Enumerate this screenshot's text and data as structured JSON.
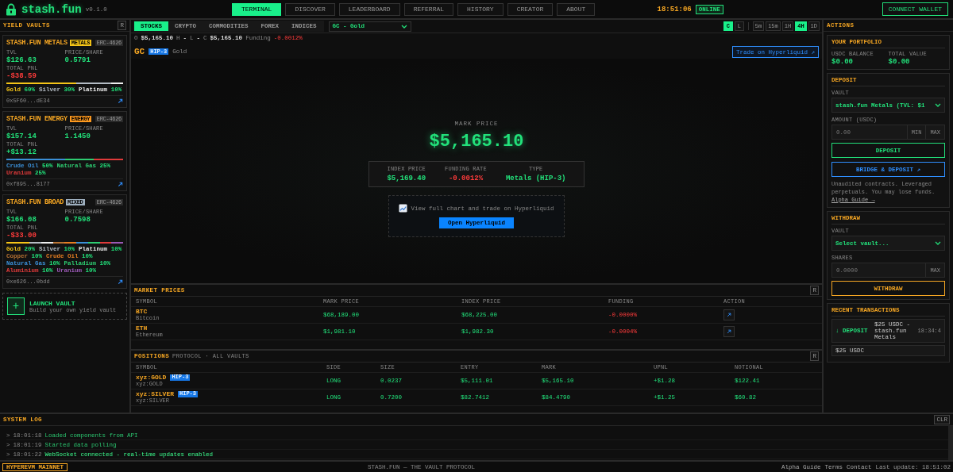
{
  "header": {
    "logo": "stash.fun",
    "version": "v0.1.0",
    "nav": [
      {
        "label": "TERMINAL",
        "selected": true
      },
      {
        "label": "DISCOVER",
        "selected": false
      },
      {
        "label": "LEADERBOARD",
        "selected": false
      },
      {
        "label": "REFERRAL",
        "selected": false
      },
      {
        "label": "HISTORY",
        "selected": false
      },
      {
        "label": "CREATOR",
        "selected": false
      },
      {
        "label": "ABOUT",
        "selected": false
      }
    ],
    "clock": "18:51:06",
    "status": "ONLINE",
    "connect": "CONNECT WALLET"
  },
  "vaults_panel": {
    "title": "YIELD VAULTS",
    "refresh": "R",
    "vaults": [
      {
        "name": "STASH.FUN METALS",
        "badge": {
          "label": "METALS",
          "color": "#f5c518"
        },
        "standard": "ERC-4626",
        "tvl_label": "TVL",
        "tvl": "$126.63",
        "price_label": "PRICE/SHARE",
        "price": "0.5791",
        "pnl_label": "TOTAL PNL",
        "pnl": "-$38.59",
        "pnl_positive": false,
        "allocations": [
          {
            "name": "Gold",
            "pct": "60%",
            "color": "#f5c518"
          },
          {
            "name": "Silver",
            "pct": "30%",
            "color": "#b4bcc4"
          },
          {
            "name": "Platinum",
            "pct": "10%",
            "color": "#eeeeee"
          }
        ],
        "address": "0x5F60...dE34"
      },
      {
        "name": "STASH.FUN ENERGY",
        "badge": {
          "label": "ENERGY",
          "color": "#ff9a1f"
        },
        "standard": "ERC-4626",
        "tvl_label": "TVL",
        "tvl": "$157.14",
        "price_label": "PRICE/SHARE",
        "price": "1.1450",
        "pnl_label": "TOTAL PNL",
        "pnl": "+$13.12",
        "pnl_positive": true,
        "allocations": [
          {
            "name": "Crude Oil",
            "pct": "50%",
            "color": "#3b8fd6"
          },
          {
            "name": "Natural Gas",
            "pct": "25%",
            "color": "#2ecc71"
          },
          {
            "name": "Uranium",
            "pct": "25%",
            "color": "#e03a3a"
          }
        ],
        "address": "0xf895...8177"
      },
      {
        "name": "STASH.FUN BROAD",
        "badge": {
          "label": "MIXED",
          "color": "#9fb0c0"
        },
        "standard": "ERC-4626",
        "tvl_label": "TVL",
        "tvl": "$166.08",
        "price_label": "PRICE/SHARE",
        "price": "0.7598",
        "pnl_label": "TOTAL PNL",
        "pnl": "-$33.00",
        "pnl_positive": false,
        "allocations": [
          {
            "name": "Gold",
            "pct": "20%",
            "color": "#f5c518"
          },
          {
            "name": "Silver",
            "pct": "10%",
            "color": "#b4bcc4"
          },
          {
            "name": "Platinum",
            "pct": "10%",
            "color": "#eeeeee"
          },
          {
            "name": "Copper",
            "pct": "10%",
            "color": "#b87333"
          },
          {
            "name": "Crude Oil",
            "pct": "10%",
            "color": "#e67e22"
          },
          {
            "name": "Natural Gas",
            "pct": "10%",
            "color": "#3b8fd6"
          },
          {
            "name": "Palladium",
            "pct": "10%",
            "color": "#2ecc71"
          },
          {
            "name": "Aluminium",
            "pct": "10%",
            "color": "#e03a3a"
          },
          {
            "name": "Uranium",
            "pct": "10%",
            "color": "#9b59b6"
          }
        ],
        "address": "0xe626...0bdd"
      }
    ],
    "launch": {
      "icon": "+",
      "title": "LAUNCH VAULT",
      "subtitle": "Build your own yield vault"
    }
  },
  "market": {
    "categories": [
      {
        "label": "STOCKS",
        "selected": true
      },
      {
        "label": "CRYPTO",
        "selected": false
      },
      {
        "label": "COMMODITIES",
        "selected": false
      },
      {
        "label": "FOREX",
        "selected": false
      },
      {
        "label": "INDICES",
        "selected": false
      }
    ],
    "symbol_select": "GC - Gold",
    "chart_modes": [
      {
        "label": "C",
        "selected": true
      },
      {
        "label": "L",
        "selected": false
      }
    ],
    "timeframes": [
      {
        "label": "5m",
        "selected": false
      },
      {
        "label": "15m",
        "selected": false
      },
      {
        "label": "1H",
        "selected": false
      },
      {
        "label": "4H",
        "selected": true
      },
      {
        "label": "1D",
        "selected": false
      }
    ],
    "ohlc": [
      {
        "label": "O",
        "value": "$5,165.10"
      },
      {
        "label": "H",
        "value": "-"
      },
      {
        "label": "L",
        "value": "-"
      },
      {
        "label": "C",
        "value": "$5,165.10"
      }
    ],
    "funding_label": "Funding",
    "funding": "-0.0012%",
    "instrument": {
      "symbol": "GC",
      "tag": "HIP-3",
      "name": "Gold",
      "trade_link": "Trade on Hyperliquid ↗"
    },
    "mark_label": "MARK PRICE",
    "mark_price": "$5,165.10",
    "stats": [
      {
        "label": "INDEX PRICE",
        "value": "$5,169.40",
        "kind": "up"
      },
      {
        "label": "FUNDING RATE",
        "value": "-0.0012%",
        "kind": "down"
      },
      {
        "label": "TYPE",
        "value": "Metals (HIP-3)",
        "kind": "up"
      }
    ],
    "cta_text": "View full chart and trade on Hyperliquid",
    "cta_button": "Open Hyperliquid"
  },
  "market_prices": {
    "title": "MARKET PRICES",
    "refresh": "R",
    "columns": [
      "SYMBOL",
      "MARK PRICE",
      "INDEX PRICE",
      "FUNDING",
      "ACTION"
    ],
    "rows": [
      {
        "symbol": "BTC",
        "name": "Bitcoin",
        "mark": "$68,189.00",
        "index": "$68,225.00",
        "funding": "-0.0000%"
      },
      {
        "symbol": "ETH",
        "name": "Ethereum",
        "mark": "$1,981.10",
        "index": "$1,982.30",
        "funding": "-0.0004%"
      }
    ]
  },
  "positions": {
    "title": "POSITIONS",
    "subtitle": "PROTOCOL · ALL VAULTS",
    "refresh": "R",
    "columns": [
      "SYMBOL",
      "SIDE",
      "SIZE",
      "ENTRY",
      "MARK",
      "UPNL",
      "NOTIONAL"
    ],
    "rows": [
      {
        "symbol": "xyz:GOLD",
        "tag": "HIP-3",
        "sub": "xyz:GOLD",
        "side": "LONG",
        "size": "0.0237",
        "entry": "$5,111.01",
        "mark": "$5,165.10",
        "upnl": "+$1.28",
        "notional": "$122.41"
      },
      {
        "symbol": "xyz:SILVER",
        "tag": "HIP-3",
        "sub": "xyz:SILVER",
        "side": "LONG",
        "size": "0.7200",
        "entry": "$82.7412",
        "mark": "$84.4790",
        "upnl": "+$1.25",
        "notional": "$60.82"
      }
    ]
  },
  "actions": {
    "title": "ACTIONS",
    "portfolio": {
      "title": "YOUR PORTFOLIO",
      "balance_label": "USDC BALANCE",
      "balance": "$0.00",
      "total_label": "TOTAL VALUE",
      "total": "$0.00"
    },
    "deposit": {
      "title": "DEPOSIT",
      "vault_label": "VAULT",
      "vault_value": "stash.fun Metals (TVL: $1",
      "amount_label": "AMOUNT (USDC)",
      "amount_placeholder": "0.00",
      "min": "MIN",
      "max": "MAX",
      "button": "DEPOSIT",
      "bridge_button": "BRIDGE & DEPOSIT ↗",
      "warning": "Unaudited contracts. Leveraged perpetuals. You may lose funds.",
      "guide_link": "Alpha Guide →"
    },
    "withdraw": {
      "title": "WITHDRAW",
      "vault_label": "VAULT",
      "vault_value": "Select vault...",
      "shares_label": "SHARES",
      "shares_placeholder": "0.0000",
      "max": "MAX",
      "button": "WITHDRAW"
    },
    "transactions": {
      "title": "RECENT TRANSACTIONS",
      "items": [
        {
          "arrow": "↓",
          "type": "DEPOSIT",
          "detail": "$25 USDC - stash.fun Metals",
          "time": "18:34:4"
        },
        {
          "detail": "$25 USDC"
        }
      ]
    }
  },
  "system_log": {
    "title": "SYSTEM LOG",
    "clear": "CLR",
    "entries": [
      {
        "prompt": ">",
        "time": "18:01:18",
        "message": "Loaded components from API",
        "kind": "info"
      },
      {
        "prompt": ">",
        "time": "18:01:19",
        "message": "Started data polling",
        "kind": "info"
      },
      {
        "prompt": ">",
        "time": "18:01:22",
        "message": "WebSocket connected - real-time updates enabled",
        "kind": "success"
      }
    ]
  },
  "footer": {
    "network": "HYPEREVM MAINNET",
    "tagline": "STASH.FUN — THE VAULT PROTOCOL",
    "links": [
      "Alpha Guide",
      "Terms",
      "Contact"
    ],
    "last_update": "Last update: 18:51:02"
  }
}
